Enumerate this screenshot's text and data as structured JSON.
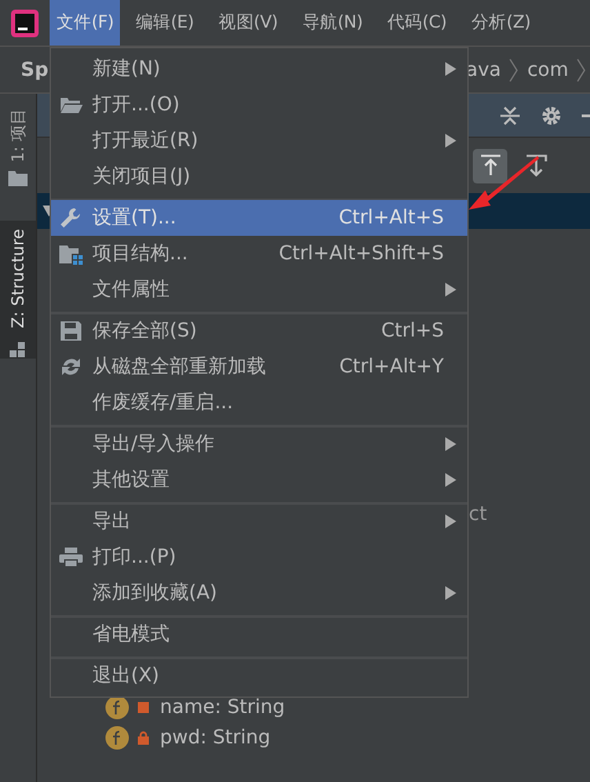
{
  "menubar": [
    {
      "label": "文件(F)",
      "selected": true
    },
    {
      "label": "编辑(E)",
      "selected": false
    },
    {
      "label": "视图(V)",
      "selected": false
    },
    {
      "label": "导航(N)",
      "selected": false
    },
    {
      "label": "代码(C)",
      "selected": false
    },
    {
      "label": "分析(Z)",
      "selected": false
    }
  ],
  "breadcrumb": {
    "project": "Sp",
    "path": [
      "ava",
      "com"
    ]
  },
  "side_tabs": [
    {
      "label": "1: 项目",
      "selected": false
    },
    {
      "label": "Z: Structure",
      "selected": true
    }
  ],
  "tree": {
    "partial_text": "ct",
    "fields": [
      {
        "label": "name: String"
      },
      {
        "label": "pwd: String"
      }
    ]
  },
  "file_menu": [
    {
      "kind": "item",
      "label": "新建(N)",
      "submenu": true,
      "selected": false
    },
    {
      "kind": "item",
      "label": "打开...(O)",
      "submenu": false,
      "selected": false
    },
    {
      "kind": "item",
      "label": "打开最近(R)",
      "submenu": true,
      "selected": false
    },
    {
      "kind": "item",
      "label": "关闭项目(J)",
      "submenu": false,
      "selected": false
    },
    {
      "kind": "separator"
    },
    {
      "kind": "item",
      "label": "设置(T)...",
      "shortcut": "Ctrl+Alt+S",
      "submenu": false,
      "selected": true
    },
    {
      "kind": "item",
      "label": "项目结构...",
      "shortcut": "Ctrl+Alt+Shift+S",
      "submenu": false,
      "selected": false
    },
    {
      "kind": "item",
      "label": "文件属性",
      "submenu": true,
      "selected": false
    },
    {
      "kind": "separator"
    },
    {
      "kind": "item",
      "label": "保存全部(S)",
      "shortcut": "Ctrl+S",
      "submenu": false,
      "selected": false
    },
    {
      "kind": "item",
      "label": "从磁盘全部重新加载",
      "shortcut": "Ctrl+Alt+Y",
      "submenu": false,
      "selected": false
    },
    {
      "kind": "item",
      "label": "作废缓存/重启...",
      "submenu": false,
      "selected": false
    },
    {
      "kind": "separator"
    },
    {
      "kind": "item",
      "label": "导出/导入操作",
      "submenu": true,
      "selected": false
    },
    {
      "kind": "item",
      "label": "其他设置",
      "submenu": true,
      "selected": false
    },
    {
      "kind": "separator"
    },
    {
      "kind": "item",
      "label": "导出",
      "submenu": true,
      "selected": false
    },
    {
      "kind": "item",
      "label": "打印...(P)",
      "submenu": false,
      "selected": false
    },
    {
      "kind": "item",
      "label": "添加到收藏(A)",
      "submenu": true,
      "selected": false
    },
    {
      "kind": "separator"
    },
    {
      "kind": "item",
      "label": "省电模式",
      "submenu": false,
      "selected": false
    },
    {
      "kind": "separator"
    },
    {
      "kind": "item",
      "label": "退出(X)",
      "submenu": false,
      "selected": false
    }
  ]
}
